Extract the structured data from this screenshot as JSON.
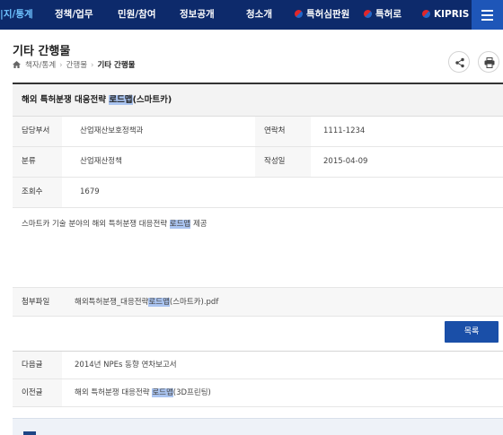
{
  "nav": {
    "items": [
      "|지/통계",
      "정책/업무",
      "민원/참여",
      "정보공개",
      "청소개"
    ],
    "external": [
      "특허심판원",
      "특허로",
      "KIPRIS"
    ]
  },
  "page": {
    "title": "기타 간행물",
    "breadcrumb": [
      "책자/통계",
      "간행물",
      "기타 간행물"
    ]
  },
  "detail": {
    "subject_pre": "해외 특허분쟁 대응전략 ",
    "subject_hl": "로드맵",
    "subject_post": "(스마트카)",
    "dept_label": "담당부서",
    "dept_value": "산업재산보호정책과",
    "contact_label": "연락처",
    "contact_value": "1111-1234",
    "category_label": "분류",
    "category_value": "산업재산정책",
    "date_label": "작성일",
    "date_value": "2015-04-09",
    "views_label": "조회수",
    "views_value": "1679",
    "content_pre": "스마트카 기술 분야의 해외 특허분쟁 대응전략 ",
    "content_hl": "로드맵",
    "content_post": " 제공",
    "attach_label": "첨부파일",
    "attach_pre": "해외특허분쟁_대응전략",
    "attach_hl": "로드맵",
    "attach_post": "(스마트카).pdf"
  },
  "list_button": "목록",
  "nav_table": {
    "next_label": "다음글",
    "next_value": "2014년 NPEs 동향 연차보고서",
    "prev_label": "이전글",
    "prev_pre": "해외 특허분쟁 대응전략 ",
    "prev_hl": "로드맵",
    "prev_post": "(3D프린팅)"
  },
  "colors": {
    "nav_bg": "#0d2a6b",
    "highlight": "#aac4f0",
    "button": "#1a4fa8"
  }
}
